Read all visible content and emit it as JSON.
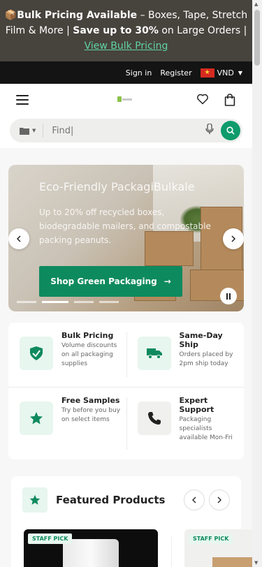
{
  "announcement": {
    "emoji": "📦",
    "bold_lead": "Bulk Pricing Available",
    "text1": " – Boxes, Tape, Stretch Film & More  |  ",
    "bold_save": "Save up to 30%",
    "text2": " on Large Orders  |  ",
    "link": "View Bulk Pricing"
  },
  "account_bar": {
    "signin": "Sign in",
    "register": "Register",
    "currency": "VND"
  },
  "search": {
    "placeholder": "Find|"
  },
  "hero": {
    "title": "Eco-Friendly PackagiBulkale",
    "subtitle": "Up to 20% off recycled boxes, biodegradable mailers, and compostable packing peanuts.",
    "cta": "Shop Green Packaging",
    "slides_total": 4,
    "active_slide": 2
  },
  "features": [
    {
      "title": "Bulk Pricing",
      "desc": "Volume discounts on all packaging supplies",
      "icon": "shield-check-icon"
    },
    {
      "title": "Same-Day Ship",
      "desc": "Orders placed by 2pm ship today",
      "icon": "truck-icon"
    },
    {
      "title": "Free Samples",
      "desc": "Try before you buy on select items",
      "icon": "star-icon"
    },
    {
      "title": "Expert Support",
      "desc": "Packaging specialists available Mon-Fri",
      "icon": "phone-icon"
    }
  ],
  "featured": {
    "title": "Featured Products",
    "badges": [
      "STAFF PICK",
      "STAFF PICK"
    ]
  },
  "colors": {
    "accent": "#0f9b6c",
    "announcement_bg": "#47433d",
    "account_bg": "#141414",
    "link": "#5fd3a4"
  }
}
